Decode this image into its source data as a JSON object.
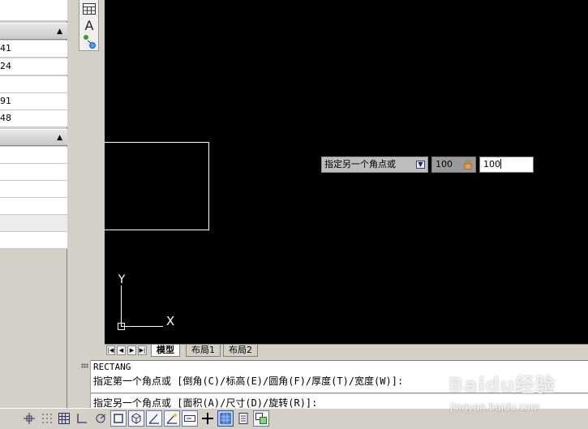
{
  "properties_palette": {
    "rows_group1": [
      "",
      "41",
      "24",
      "",
      "91",
      "48"
    ],
    "rows_group2": [
      "",
      "",
      "",
      "",
      "",
      ""
    ]
  },
  "vertical_toolbar": {
    "tools": [
      "table-icon",
      "text-icon",
      "attribute-icon"
    ],
    "text_glyph": "A"
  },
  "canvas": {
    "background": "#000000",
    "ucs_axis_y": "Y",
    "ucs_axis_x": "X"
  },
  "dynamic_input": {
    "prompt": "指定另一个角点或",
    "locked_value": "100",
    "current_value": "100"
  },
  "layout_tabs": [
    {
      "label": "模型",
      "active": true
    },
    {
      "label": "布局1",
      "active": false
    },
    {
      "label": "布局2",
      "active": false
    }
  ],
  "command_window": {
    "line1": "RECTANG",
    "line2": "指定第一个角点或 [倒角(C)/标高(E)/圆角(F)/厚度(T)/宽度(W)]:",
    "line3": "指定另一个角点或 [面积(A)/尺寸(D)/旋转(R)]:"
  },
  "status_bar": {
    "buttons": [
      {
        "icon": "snap-icon",
        "state": "off"
      },
      {
        "icon": "grid-icon",
        "state": "off"
      },
      {
        "icon": "grid-display-icon",
        "state": "off"
      },
      {
        "icon": "ortho-icon",
        "state": "off"
      },
      {
        "icon": "polar-icon",
        "state": "off"
      },
      {
        "icon": "osnap-icon",
        "state": "on"
      },
      {
        "icon": "3d-osnap-icon",
        "state": "on"
      },
      {
        "icon": "otrack-icon",
        "state": "on"
      },
      {
        "icon": "ducs-icon",
        "state": "on"
      },
      {
        "icon": "dynamic-input-icon",
        "state": "on"
      },
      {
        "icon": "lineweight-icon",
        "state": "off"
      },
      {
        "icon": "transparency-icon",
        "state": "pressed"
      },
      {
        "icon": "quick-properties-icon",
        "state": "off"
      },
      {
        "icon": "selection-cycling-icon",
        "state": "on"
      }
    ]
  },
  "watermark": {
    "logo": "Baidu经验",
    "url": "jingyan.baidu.com"
  }
}
